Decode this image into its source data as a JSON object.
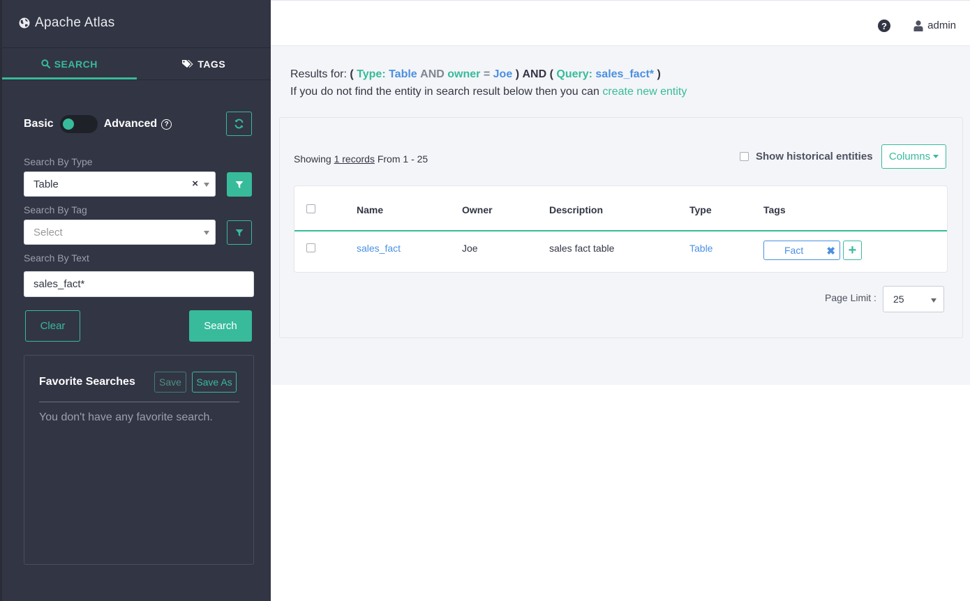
{
  "brand": {
    "title": "Apache Atlas",
    "icon": "globe-icon"
  },
  "sidebar": {
    "tabs": [
      {
        "label": "SEARCH",
        "icon": "search-icon",
        "active": true
      },
      {
        "label": "TAGS",
        "icon": "tags-icon",
        "active": false
      }
    ],
    "toggle": {
      "left_label": "Basic",
      "right_label": "Advanced",
      "state": "basic"
    },
    "search_by_type": {
      "label": "Search By Type",
      "value": "Table",
      "clear": "×"
    },
    "search_by_tag": {
      "label": "Search By Tag",
      "placeholder": "Select"
    },
    "search_by_text": {
      "label": "Search By Text",
      "value": "sales_fact*"
    },
    "buttons": {
      "clear": "Clear",
      "search": "Search"
    },
    "favorites": {
      "title": "Favorite Searches",
      "save": "Save",
      "save_as": "Save As",
      "empty_text": "You don't have any favorite search."
    }
  },
  "topbar": {
    "help": "?",
    "user": "admin"
  },
  "results": {
    "prefix": "Results for:",
    "open1": "(",
    "type_key": "Type:",
    "type_value": "Table",
    "and1": "AND",
    "owner_key": "owner",
    "eq": "=",
    "owner_value": "Joe",
    "close1": ")",
    "and2": "AND",
    "open2": "(",
    "query_key": "Query:",
    "query_value": "sales_fact*",
    "close2": ")",
    "info_text": "If you do not find the entity in search result below then you can",
    "info_link": "create new entity"
  },
  "panel": {
    "showing_prefix": "Showing",
    "records_link": "1 records",
    "showing_suffix": "From 1 - 25",
    "historical_label": "Show historical entities",
    "columns_button": "Columns",
    "page_limit_label": "Page Limit :",
    "page_limit_value": "25"
  },
  "table": {
    "headers": [
      "Name",
      "Owner",
      "Description",
      "Type",
      "Tags"
    ],
    "rows": [
      {
        "name": "sales_fact",
        "owner": "Joe",
        "description": "sales fact table",
        "type": "Table",
        "tag": "Fact",
        "tag_remove": "✖",
        "add_tag": "+"
      }
    ]
  },
  "colors": {
    "accent": "#37bb9b",
    "link": "#4a90e2",
    "sidebar": "#323544"
  }
}
